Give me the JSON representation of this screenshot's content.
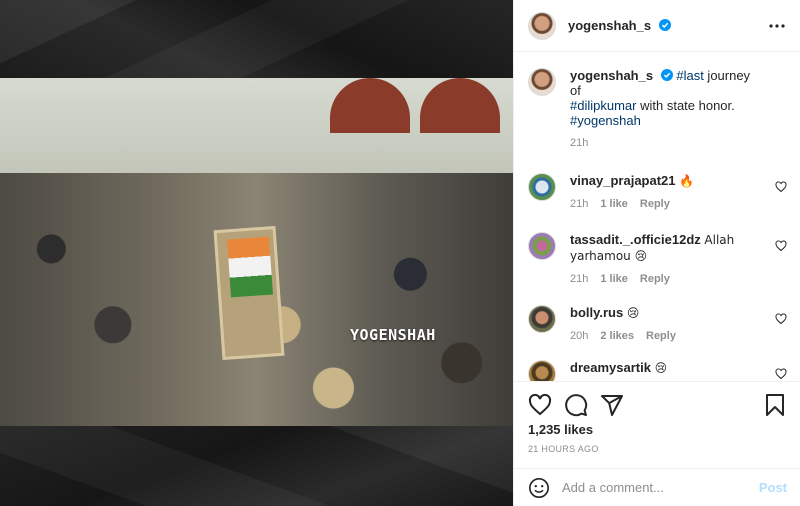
{
  "post": {
    "username": "yogenshah_s",
    "verified": true,
    "watermark": "YOGENSHAH",
    "caption": {
      "username": "yogenshah_s",
      "tag_last": "#last",
      "text_1": " journey of ",
      "tag_dilip": "#dilipkumar",
      "text_2": " with state honor. ",
      "tag_yogen": "#yogenshah",
      "time": "21h"
    },
    "comments": [
      {
        "username": "vinay_prajapat21",
        "text": "🔥",
        "time": "21h",
        "likes": "1 like",
        "reply": "Reply"
      },
      {
        "username": "tassadit._.officie12dz",
        "text": "Allah yarhamou 😢",
        "time": "21h",
        "likes": "1 like",
        "reply": "Reply"
      },
      {
        "username": "bolly.rus",
        "text": "😢",
        "time": "20h",
        "likes": "2 likes",
        "reply": "Reply"
      },
      {
        "username": "dreamysartik",
        "text": "😢",
        "time": "",
        "likes": "",
        "reply": ""
      }
    ],
    "likes_count": "1,235 likes",
    "time_ago": "21 HOURS AGO",
    "add_comment_placeholder": "Add a comment...",
    "post_label": "Post"
  },
  "colors": {
    "verified_blue": "#0095f6",
    "tag_blue": "#00376b",
    "post_disabled": "#b2dffc"
  },
  "icons": [
    "more-icon",
    "verified-icon",
    "heart-icon",
    "comment-icon",
    "share-icon",
    "bookmark-icon",
    "emoji-icon"
  ]
}
